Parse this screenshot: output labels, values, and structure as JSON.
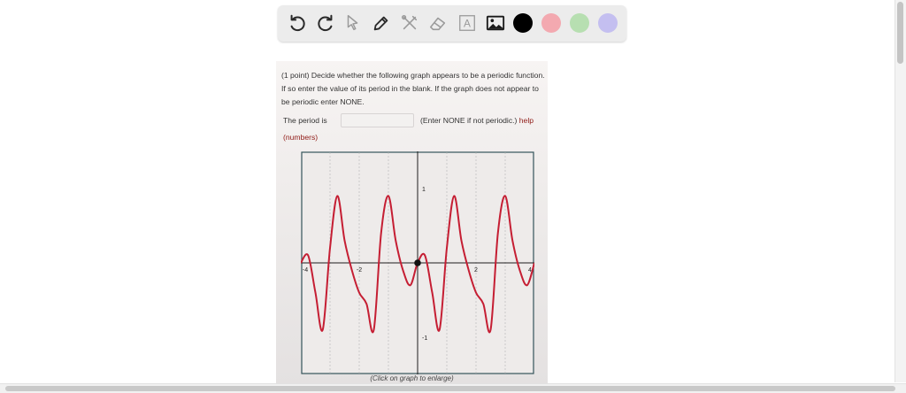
{
  "toolbar": {
    "tools": [
      {
        "name": "undo-icon"
      },
      {
        "name": "redo-icon"
      },
      {
        "name": "pointer-icon"
      },
      {
        "name": "pen-icon"
      },
      {
        "name": "tools-icon"
      },
      {
        "name": "eraser-icon"
      },
      {
        "name": "text-icon",
        "glyph": "A"
      },
      {
        "name": "image-icon"
      }
    ],
    "colors": [
      "#000000",
      "#f3a9b0",
      "#b7dfb1",
      "#c4bff0"
    ]
  },
  "problem": {
    "intro": "(1 point) Decide whether the following graph appears to be a periodic function. If so enter the value of its period in the blank. If the graph does not appear to be periodic enter NONE.",
    "period_label": "The period is",
    "period_value": "",
    "period_hint": "(Enter NONE if not periodic.)",
    "help_label": "help",
    "numbers_label": "(numbers)",
    "caption": "(Click on graph to enlarge)"
  },
  "graph": {
    "x_tick_labels": [
      "-4",
      "-2",
      "2",
      "4"
    ],
    "y_tick_labels": [
      "1",
      "-1"
    ],
    "line_color": "#c51e33"
  },
  "chart_data": {
    "type": "line",
    "title": "",
    "xlabel": "",
    "ylabel": "",
    "xlim": [
      -4,
      4
    ],
    "ylim": [
      -1.5,
      1.5
    ],
    "grid": true,
    "series": [
      {
        "x": [
          -4,
          -3.75,
          -3.5,
          -3.25,
          -3,
          -2.75,
          -2.5,
          -2.25,
          -2,
          -1.75,
          -1.5,
          -1.25,
          -1,
          -0.75,
          -0.5,
          -0.25,
          0,
          0.25,
          0.5,
          0.75,
          1,
          1.25,
          1.5,
          1.75,
          2,
          2.25,
          2.5,
          2.75,
          3,
          3.25,
          3.5,
          3.75,
          4
        ],
        "y": [
          0,
          0.1,
          -0.4,
          -0.9,
          0.2,
          0.9,
          0.3,
          -0.1,
          -0.4,
          -0.55,
          -0.9,
          0.4,
          0.9,
          0.3,
          -0.1,
          -0.3,
          0,
          0.1,
          -0.4,
          -0.9,
          0.2,
          0.9,
          0.3,
          -0.1,
          -0.4,
          -0.55,
          -0.9,
          0.4,
          0.9,
          0.3,
          -0.1,
          -0.3,
          0
        ]
      }
    ]
  }
}
